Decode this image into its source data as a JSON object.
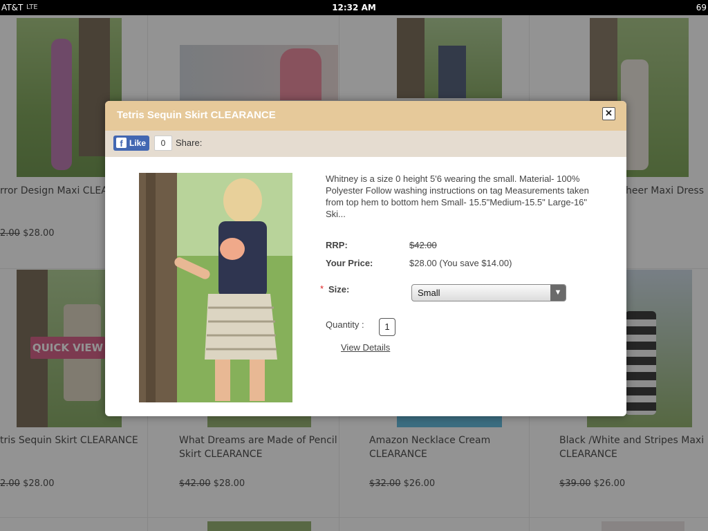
{
  "status_bar": {
    "carrier": "AT&T",
    "network": "LTE",
    "time": "12:32 AM",
    "battery": "69"
  },
  "background": {
    "row1": [
      {
        "title": "rror Design Maxi CLEA",
        "old_price": "2.00",
        "price": "$28.00"
      },
      {
        "title": "",
        "old_price": "",
        "price": ""
      },
      {
        "title": "",
        "old_price": "",
        "price": ""
      },
      {
        "title": "heer Maxi Dress",
        "old_price": "",
        "price": ""
      }
    ],
    "row2": [
      {
        "title": "tris Sequin Skirt CLEARANCE",
        "old_price": "2.00",
        "price": "$28.00"
      },
      {
        "title_line1": "What Dreams are Made of Pencil",
        "title_line2": "Skirt CLEARANCE",
        "old_price": "$42.00",
        "price": "$28.00"
      },
      {
        "title_line1": "Amazon Necklace Cream",
        "title_line2": "CLEARANCE",
        "old_price": "$32.00",
        "price": "$26.00"
      },
      {
        "title_line1": "Black /White and Stripes Maxi",
        "title_line2": "CLEARANCE",
        "old_price": "$39.00",
        "price": "$26.00"
      }
    ],
    "quick_view_label": "QUICK VIEW"
  },
  "modal": {
    "title": "Tetris Sequin Skirt CLEARANCE",
    "close_glyph": "✕",
    "like_label": "Like",
    "like_count": "0",
    "share_label": "Share:",
    "description": "Whitney is a size 0 height 5'6 wearing the small. Material- 100% Polyester Follow washing instructions on tag Measurements taken from top hem to bottom hem Small- 15.5\"Medium-15.5\" Large-16\" Ski...",
    "rrp_label": "RRP:",
    "rrp_value": "$42.00",
    "your_price_label": "Your Price:",
    "your_price_value": "$28.00 (You save $14.00)",
    "size_label": "Size:",
    "size_selected": "Small",
    "quantity_label": "Quantity :",
    "quantity_value": "1",
    "view_details_label": "View Details"
  },
  "colors": {
    "modal_header": "#e6c99a",
    "share_bar": "#e5dcd0",
    "facebook": "#4267b2",
    "quick_view": "#d04c78"
  }
}
